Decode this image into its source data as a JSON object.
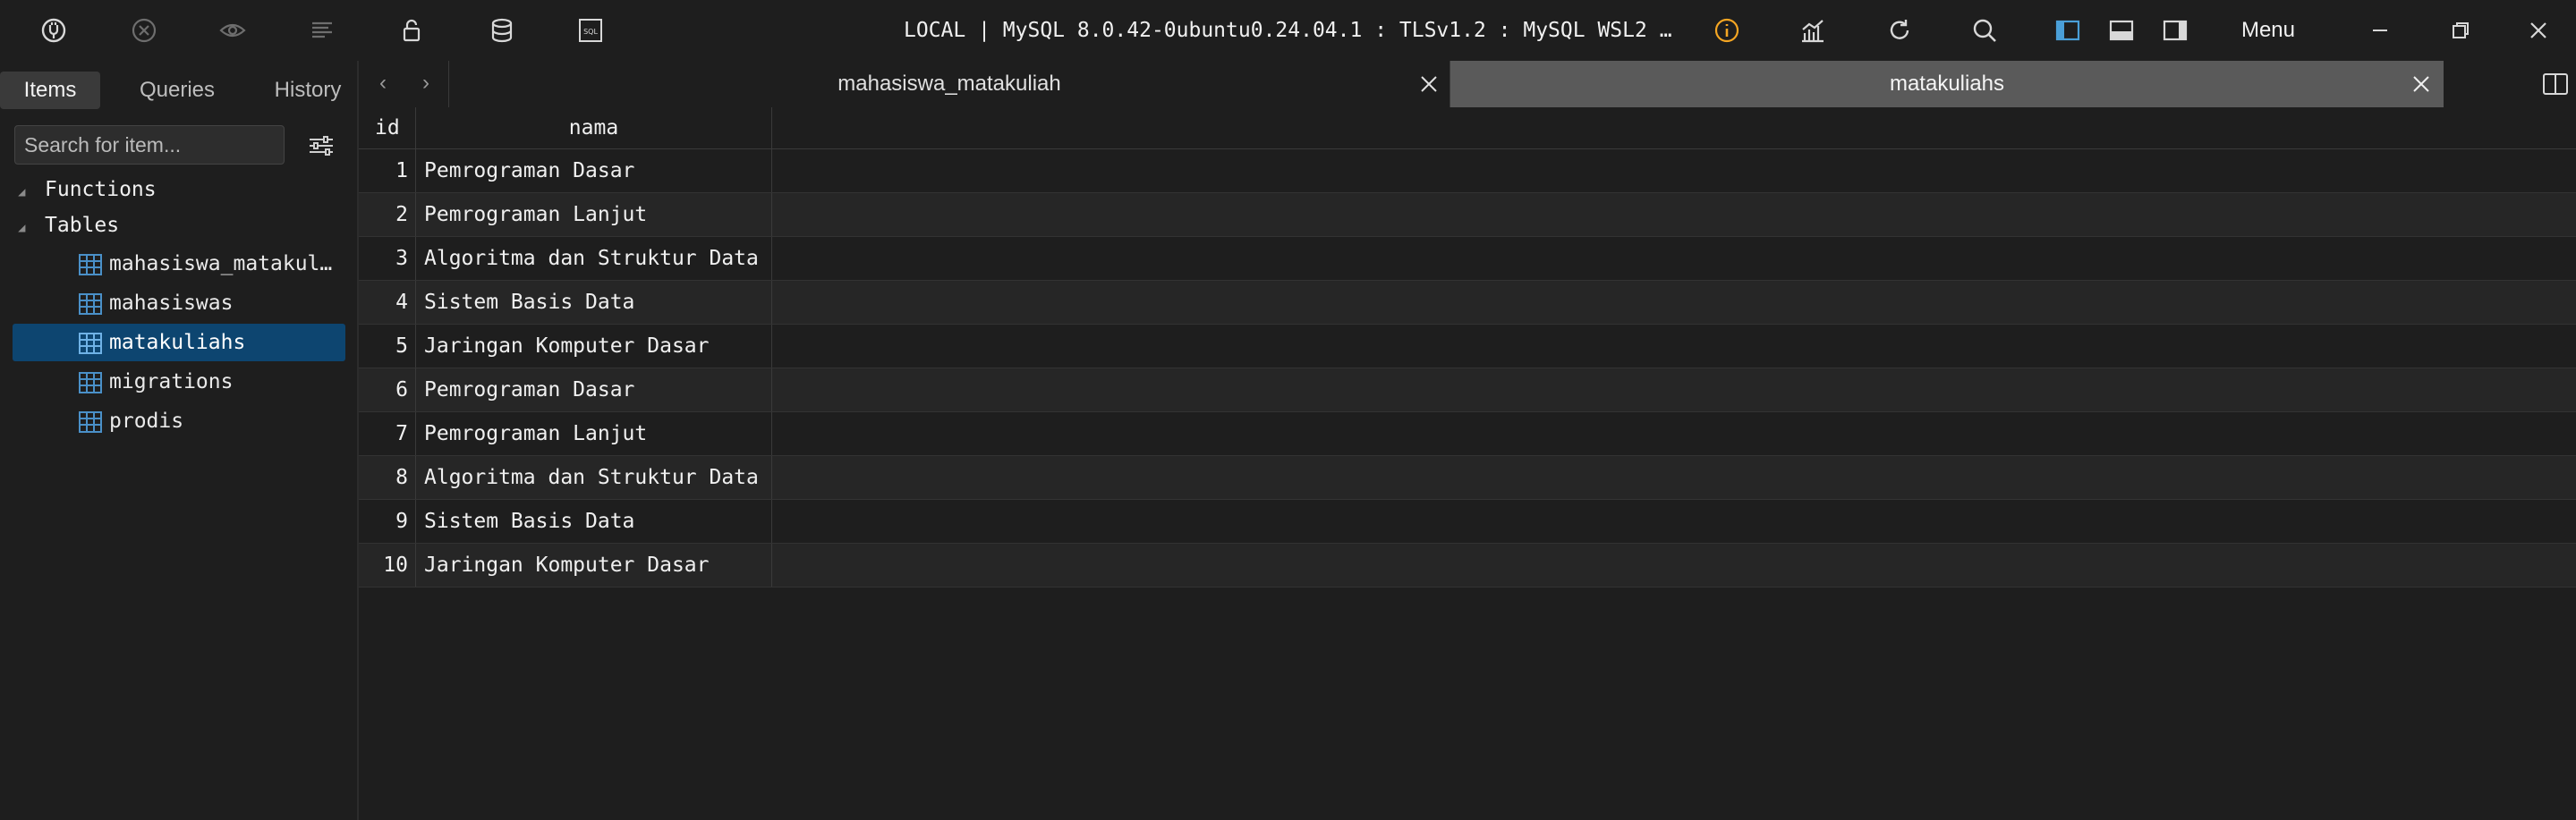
{
  "toolbar": {
    "connection_title": "LOCAL | MySQL 8.0.42-0ubuntu0.24.04.1 : TLSv1.2 : MySQL WSL2 :…",
    "menu_label": "Menu",
    "icons": [
      "connect-icon",
      "stop-icon",
      "eye-icon",
      "format-icon",
      "lock-icon",
      "database-icon",
      "sql-icon",
      "info-icon",
      "chart-icon",
      "refresh-icon",
      "search-icon",
      "layout-left-icon",
      "layout-bottom-icon",
      "layout-right-icon",
      "minimize-icon",
      "restore-icon",
      "close-icon"
    ],
    "accent_info": "#f5a623",
    "accent_layout": "#4a9fd8"
  },
  "sidebar": {
    "tabs": [
      {
        "label": "Items",
        "active": true
      },
      {
        "label": "Queries",
        "active": false
      },
      {
        "label": "History",
        "active": false
      }
    ],
    "search_placeholder": "Search for item...",
    "groups": [
      {
        "label": "Functions"
      },
      {
        "label": "Tables"
      }
    ],
    "tables": [
      {
        "label": "mahasiswa_matakul…",
        "selected": false
      },
      {
        "label": "mahasiswas",
        "selected": false
      },
      {
        "label": "matakuliahs",
        "selected": true
      },
      {
        "label": "migrations",
        "selected": false
      },
      {
        "label": "prodis",
        "selected": false
      }
    ]
  },
  "tabs": [
    {
      "label": "mahasiswa_matakuliah",
      "active": false
    },
    {
      "label": "matakuliahs",
      "active": true
    }
  ],
  "grid": {
    "columns": [
      "id",
      "nama"
    ],
    "rows": [
      {
        "id": "1",
        "nama": "Pemrograman Dasar"
      },
      {
        "id": "2",
        "nama": "Pemrograman Lanjut"
      },
      {
        "id": "3",
        "nama": "Algoritma dan Struktur Data"
      },
      {
        "id": "4",
        "nama": "Sistem Basis Data"
      },
      {
        "id": "5",
        "nama": "Jaringan Komputer Dasar"
      },
      {
        "id": "6",
        "nama": "Pemrograman Dasar"
      },
      {
        "id": "7",
        "nama": "Pemrograman Lanjut"
      },
      {
        "id": "8",
        "nama": "Algoritma dan Struktur Data"
      },
      {
        "id": "9",
        "nama": "Sistem Basis Data"
      },
      {
        "id": "10",
        "nama": "Jaringan Komputer Dasar"
      }
    ]
  }
}
